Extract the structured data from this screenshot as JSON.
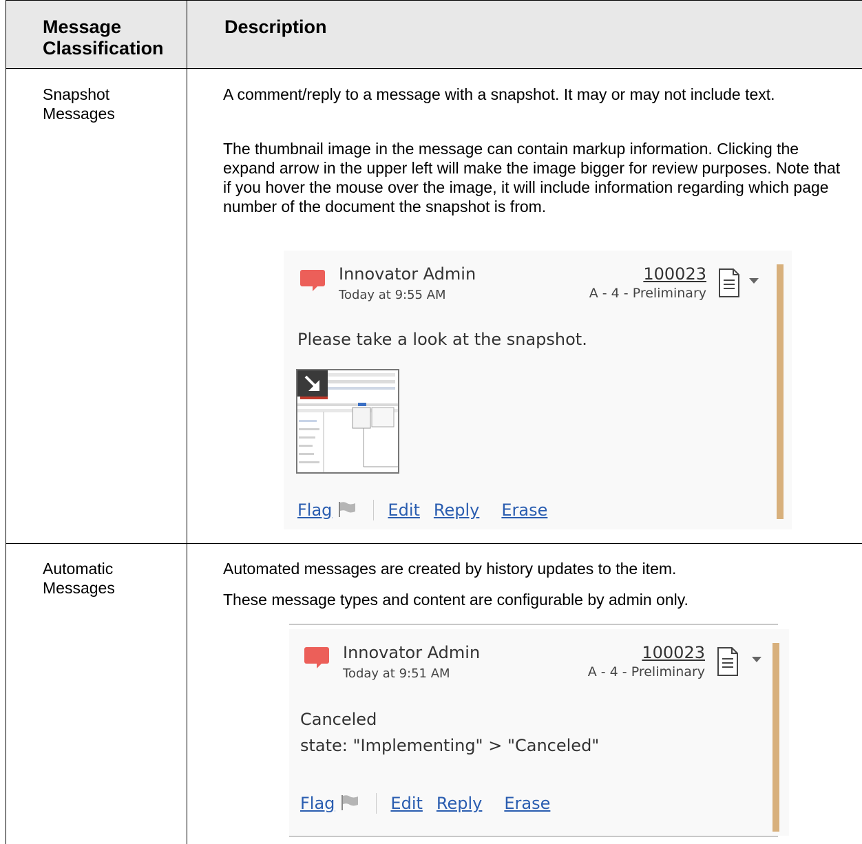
{
  "table": {
    "header": {
      "col1": "Message Classification",
      "col2": "Description"
    },
    "rows": [
      {
        "label": "Snapshot Messages",
        "paragraphs": [
          "A comment/reply to a message with a snapshot. It may or may not include text.",
          "The thumbnail image in the message can contain markup information. Clicking the expand arrow in the upper left will make the image bigger for review purposes.  Note that if you hover the mouse over the image, it will include information regarding which page number of the document the snapshot is from."
        ],
        "card": {
          "author": "Innovator Admin",
          "time": "Today at 9:55 AM",
          "item_number": "100023",
          "revision": "A - 4 - Preliminary",
          "body": "Please take a look at the snapshot.",
          "actions": {
            "flag": "Flag",
            "edit": "Edit",
            "reply": "Reply",
            "erase": "Erase"
          }
        }
      },
      {
        "label": "Automatic Messages",
        "paragraphs": [
          "Automated messages are created by history updates to the item.",
          "These message types and content are configurable by admin only."
        ],
        "card": {
          "author": "Innovator Admin",
          "time": "Today at 9:51 AM",
          "item_number": "100023",
          "revision": "A - 4 - Preliminary",
          "body_line1": "Canceled",
          "body_line2": "state: \"Implementing\" > \"Canceled\"",
          "actions": {
            "flag": "Flag",
            "edit": "Edit",
            "reply": "Reply",
            "erase": "Erase"
          }
        }
      }
    ]
  },
  "colors": {
    "header_bg": "#e8e8e8",
    "bubble": "#ec5f59",
    "accent_bar": "#d8b07c",
    "link": "#2a5db0"
  },
  "icons": [
    "comment-bubble-icon",
    "document-icon",
    "dropdown-arrow-icon",
    "flag-icon",
    "expand-arrow-icon"
  ]
}
